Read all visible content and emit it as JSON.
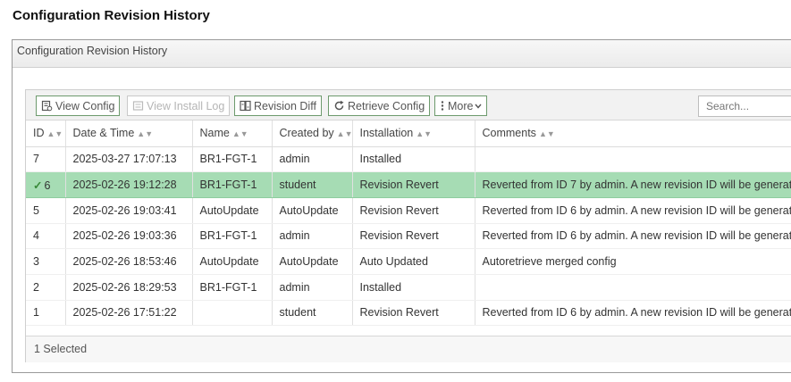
{
  "page_title": "Configuration Revision History",
  "panel_title": "Configuration Revision History",
  "toolbar": {
    "view_config": "View Config",
    "view_install_log": "View Install Log",
    "revision_diff": "Revision Diff",
    "retrieve_config": "Retrieve Config",
    "more": "More",
    "search_placeholder": "Search..."
  },
  "columns": [
    "ID",
    "Date & Time",
    "Name",
    "Created by",
    "Installation",
    "Comments"
  ],
  "rows": [
    {
      "id": "7",
      "datetime": "2025-03-27 17:07:13",
      "name": "BR1-FGT-1",
      "created_by": "admin",
      "installation": "Installed",
      "comments": ""
    },
    {
      "id": "6",
      "datetime": "2025-02-26 19:12:28",
      "name": "BR1-FGT-1",
      "created_by": "student",
      "installation": "Revision Revert",
      "comments": "Reverted from ID 7 by admin. A new revision ID will be generat"
    },
    {
      "id": "5",
      "datetime": "2025-02-26 19:03:41",
      "name": "AutoUpdate",
      "created_by": "AutoUpdate",
      "installation": "Revision Revert",
      "comments": "Reverted from ID 6 by admin. A new revision ID will be generat"
    },
    {
      "id": "4",
      "datetime": "2025-02-26 19:03:36",
      "name": "BR1-FGT-1",
      "created_by": "admin",
      "installation": "Revision Revert",
      "comments": "Reverted from ID 6 by admin. A new revision ID will be generat"
    },
    {
      "id": "3",
      "datetime": "2025-02-26 18:53:46",
      "name": "AutoUpdate",
      "created_by": "AutoUpdate",
      "installation": "Auto Updated",
      "comments": "Autoretrieve merged config"
    },
    {
      "id": "2",
      "datetime": "2025-02-26 18:29:53",
      "name": "BR1-FGT-1",
      "created_by": "admin",
      "installation": "Installed",
      "comments": ""
    },
    {
      "id": "1",
      "datetime": "2025-02-26 17:51:22",
      "name": "",
      "created_by": "student",
      "installation": "Revision Revert",
      "comments": "Reverted from ID 6 by admin. A new revision ID will be generat"
    }
  ],
  "footer": {
    "selected_text": "1 Selected"
  },
  "colors": {
    "selected_row": "#a6dcb4",
    "button_border": "#6d9a6d"
  }
}
